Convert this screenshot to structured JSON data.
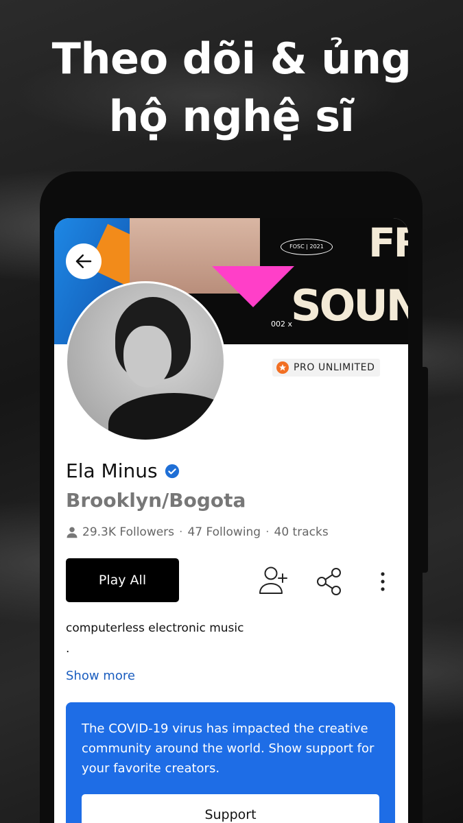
{
  "promo": {
    "headline_line1": "Theo dõi & ủng",
    "headline_line2": "hộ nghệ sĩ"
  },
  "banner": {
    "festival_badge": "FOSC | 2021",
    "festival_word": "SOUND",
    "festival_word_partial": "FR",
    "edition_text": "002 x"
  },
  "profile": {
    "badge": "PRO UNLIMITED",
    "name": "Ela Minus",
    "verified": true,
    "location": "Brooklyn/Bogota",
    "stats": {
      "followers": "29.3K Followers",
      "following": "47 Following",
      "tracks": "40 tracks",
      "separator": "·"
    },
    "bio": "computerless electronic music",
    "bio_extra": ".",
    "show_more": "Show more"
  },
  "actions": {
    "play_all": "Play All",
    "follow_icon": "add-user-icon",
    "share_icon": "share-icon",
    "more_icon": "more-vertical-icon"
  },
  "support_card": {
    "text": "The COVID-19 virus has impacted the creative community around the world. Show support for your favorite creators.",
    "button": "Support"
  },
  "colors": {
    "accent_blue": "#1e6de6",
    "link_blue": "#1a5dbf",
    "pro_orange": "#f26f23",
    "verified_blue": "#1f6fd6"
  }
}
